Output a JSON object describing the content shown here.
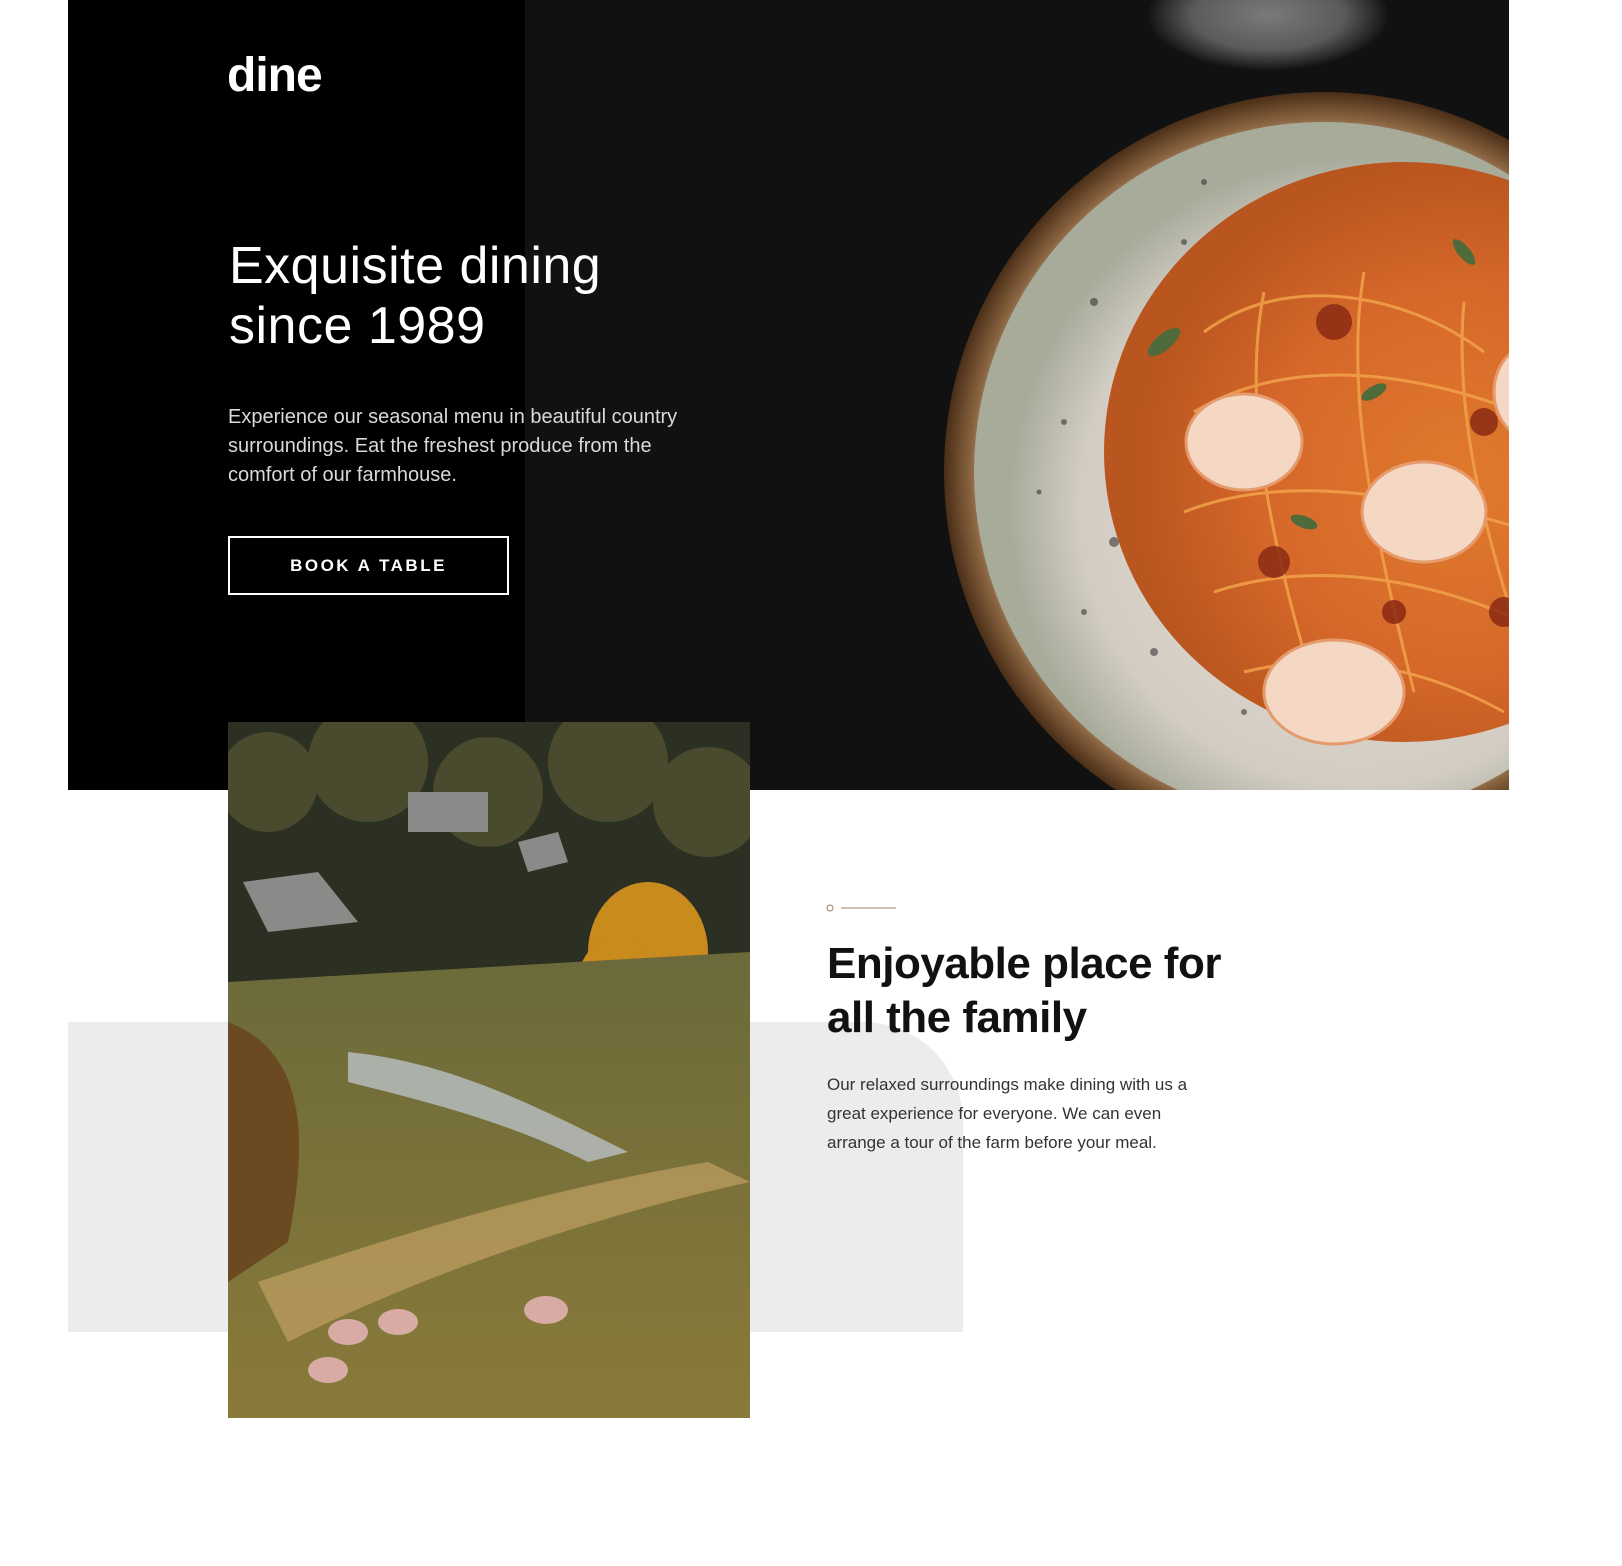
{
  "hero": {
    "logo": "dine",
    "title_line1": "Exquisite dining",
    "title_line2": "since 1989",
    "description": "Experience our seasonal menu in beautiful country surroundings. Eat the freshest produce from the comfort of our farmhouse.",
    "button_label": "BOOK A TABLE",
    "image": "pasta-plate-with-shrimp"
  },
  "feature": {
    "title_line1": "Enjoyable place for",
    "title_line2": "all the family",
    "description": "Our relaxed surroundings make dining with us a great experience for everyone. We can even arrange a tour of the farm before your meal.",
    "image": "countryside-farm-with-sheep",
    "deco_icon": "pattern-divider-icon"
  },
  "colors": {
    "hero_background": "#111111",
    "hero_panel": "#000000",
    "accent_beaver": "#9e7f66",
    "grey_block": "#ececec",
    "heading_text": "#111111"
  }
}
